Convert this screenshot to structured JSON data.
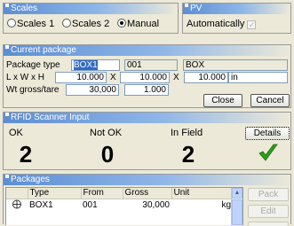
{
  "scales": {
    "title": "Scales",
    "options": [
      "Scales 1",
      "Scales 2",
      "Manual"
    ],
    "selected": "Manual"
  },
  "pv": {
    "title": "PV",
    "automatically_label": "Automatically",
    "automatically_checked": true
  },
  "current_package": {
    "title": "Current package",
    "package_type_label": "Package type",
    "package_type_value": "BOX1",
    "package_code": "001",
    "package_name": "BOX",
    "dims_label": "L x W x H",
    "length": "10.000",
    "width": "10.000",
    "height": "10.000",
    "dim_separator": "X",
    "unit": "in",
    "weight_label": "Wt gross/tare",
    "gross": "30,000",
    "tare": "1.000",
    "close_label": "Close",
    "cancel_label": "Cancel"
  },
  "rfid": {
    "title": "RFID Scanner Input",
    "ok_label": "OK",
    "ok_count": "2",
    "not_ok_label": "Not OK",
    "not_ok_count": "0",
    "in_field_label": "In Field",
    "in_field_count": "2",
    "details_label": "Details",
    "check_color": "#2e9e1a"
  },
  "packages": {
    "title": "Packages",
    "columns": [
      "Type",
      "From",
      "Gross",
      "Unit"
    ],
    "rows": [
      {
        "icon": "package-icon",
        "type": "BOX1",
        "from": "001",
        "gross": "30,000",
        "unit": "kg"
      }
    ],
    "pack_label": "Pack",
    "edit_label": "Edit"
  }
}
